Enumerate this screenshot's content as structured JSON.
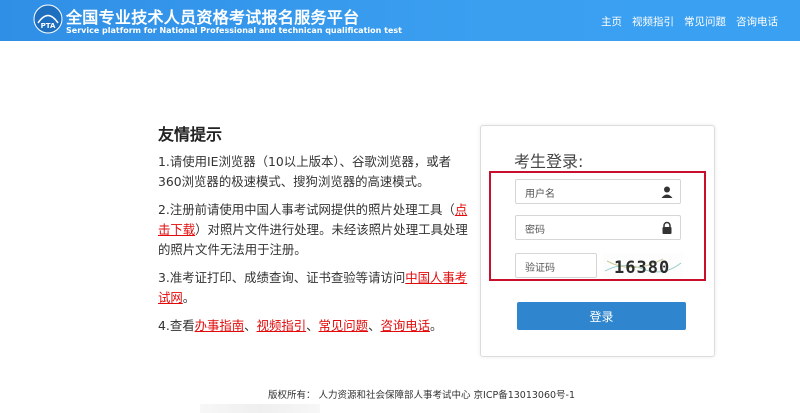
{
  "header": {
    "title_cn": "全国专业技术人员资格考试报名服务平台",
    "title_en": "Service platform for National Professional and technican qualification test",
    "logo_text": "PTA",
    "nav": [
      "主页",
      "视频指引",
      "常见问题",
      "咨询电话"
    ]
  },
  "notice": {
    "heading": "友情提示",
    "item1": "1.请使用IE浏览器（10以上版本）、谷歌浏览器，或者360浏览器的极速模式、搜狗浏览器的高速模式。",
    "item2_pre": "2.注册前请使用中国人事考试网提供的照片处理工具（",
    "item2_link": "点击下载",
    "item2_post": "）对照片文件进行处理。未经该照片处理工具处理的照片文件无法用于注册。",
    "item3_pre": "3.准考证打印、成绩查询、证书查验等请访问",
    "item3_link": "中国人事考试网",
    "item3_post": "。",
    "item4_pre": "4.查看",
    "item4_link1": "办事指南",
    "item4_link2": "视频指引",
    "item4_link3": "常见问题",
    "item4_link4": "咨询电话",
    "sep": "、",
    "end": "。"
  },
  "login": {
    "title": "考生登录:",
    "username_placeholder": "用户名",
    "password_placeholder": "密码",
    "captcha_placeholder": "验证码",
    "captcha_code": "16380",
    "button": "登录"
  },
  "footer": {
    "text": "版权所有：  人力资源和社会保障部人事考试中心  京ICP备13013060号-1"
  },
  "colors": {
    "header_bg": "#3a9cee",
    "link_red": "#e20a0a",
    "button_blue": "#2f86cf",
    "highlight_border": "#c8102e"
  }
}
